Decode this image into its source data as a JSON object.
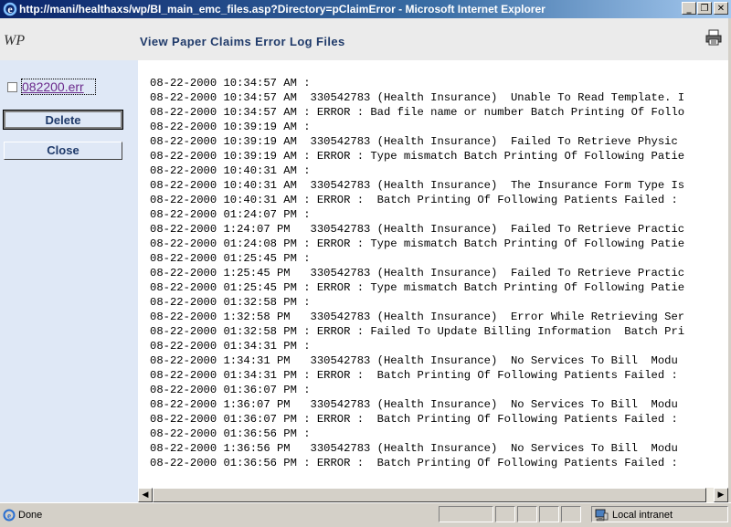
{
  "window": {
    "title": "http://mani/healthaxs/wp/BI_main_emc_files.asp?Directory=pClaimError - Microsoft Internet Explorer",
    "minimize_glyph": "_",
    "restore_glyph": "❐",
    "close_glyph": "✕"
  },
  "header": {
    "logo": "WP",
    "title": "View Paper Claims Error Log Files",
    "print_icon": "printer-icon"
  },
  "sidebar": {
    "file_name": "082200.err",
    "delete_label": "Delete",
    "close_label": "Close"
  },
  "log_lines": [
    "08-22-2000 10:34:57 AM :",
    "08-22-2000 10:34:57 AM  330542783 (Health Insurance)  Unable To Read Template. I",
    "08-22-2000 10:34:57 AM : ERROR : Bad file name or number Batch Printing Of Follo",
    "08-22-2000 10:39:19 AM :",
    "08-22-2000 10:39:19 AM  330542783 (Health Insurance)  Failed To Retrieve Physic",
    "08-22-2000 10:39:19 AM : ERROR : Type mismatch Batch Printing Of Following Patie",
    "08-22-2000 10:40:31 AM :",
    "08-22-2000 10:40:31 AM  330542783 (Health Insurance)  The Insurance Form Type Is",
    "08-22-2000 10:40:31 AM : ERROR :  Batch Printing Of Following Patients Failed :",
    "08-22-2000 01:24:07 PM :",
    "08-22-2000 1:24:07 PM   330542783 (Health Insurance)  Failed To Retrieve Practic",
    "08-22-2000 01:24:08 PM : ERROR : Type mismatch Batch Printing Of Following Patie",
    "08-22-2000 01:25:45 PM :",
    "08-22-2000 1:25:45 PM   330542783 (Health Insurance)  Failed To Retrieve Practic",
    "08-22-2000 01:25:45 PM : ERROR : Type mismatch Batch Printing Of Following Patie",
    "08-22-2000 01:32:58 PM :",
    "08-22-2000 1:32:58 PM   330542783 (Health Insurance)  Error While Retrieving Ser",
    "08-22-2000 01:32:58 PM : ERROR : Failed To Update Billing Information  Batch Pri",
    "08-22-2000 01:34:31 PM :",
    "08-22-2000 1:34:31 PM   330542783 (Health Insurance)  No Services To Bill  Modu",
    "08-22-2000 01:34:31 PM : ERROR :  Batch Printing Of Following Patients Failed :",
    "08-22-2000 01:36:07 PM :",
    "08-22-2000 1:36:07 PM   330542783 (Health Insurance)  No Services To Bill  Modu",
    "08-22-2000 01:36:07 PM : ERROR :  Batch Printing Of Following Patients Failed :",
    "08-22-2000 01:36:56 PM :",
    "08-22-2000 1:36:56 PM   330542783 (Health Insurance)  No Services To Bill  Modu",
    "08-22-2000 01:36:56 PM : ERROR :  Batch Printing Of Following Patients Failed :"
  ],
  "scrollbar": {
    "left_arrow": "◀",
    "right_arrow": "▶"
  },
  "status": {
    "text": "Done",
    "zone": "Local intranet"
  },
  "colors": {
    "title_gradient_start": "#0a246a",
    "header_title": "#1f3a6a",
    "sidebar_bg": "#dfe8f6",
    "visited_link": "#6b2a8c"
  }
}
